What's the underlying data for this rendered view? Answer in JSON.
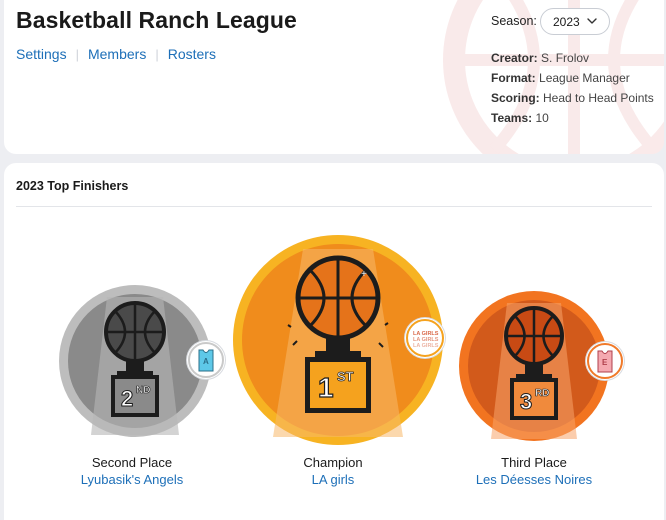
{
  "league": {
    "title": "Basketball Ranch League",
    "nav": [
      {
        "label": "Settings"
      },
      {
        "label": "Members"
      },
      {
        "label": "Rosters"
      }
    ]
  },
  "season": {
    "label": "Season:",
    "selected": "2023"
  },
  "details": [
    {
      "key": "Creator:",
      "value": "S. Frolov"
    },
    {
      "key": "Format:",
      "value": "League Manager"
    },
    {
      "key": "Scoring:",
      "value": "Head to Head Points"
    },
    {
      "key": "Teams:",
      "value": "10"
    }
  ],
  "finishers": {
    "title": "2023 Top Finishers",
    "items": [
      {
        "place": "Second Place",
        "team": "Lyubasik's Angels",
        "rank_num": "2",
        "rank_suffix": "ND",
        "icon": "trophy-icon"
      },
      {
        "place": "Champion",
        "team": "LA girls",
        "rank_num": "1",
        "rank_suffix": "ST",
        "icon": "trophy-icon"
      },
      {
        "place": "Third Place",
        "team": "Les Déesses Noires",
        "rank_num": "3",
        "rank_suffix": "RD",
        "icon": "trophy-icon"
      }
    ],
    "logo_text": "LA GIRLS"
  },
  "colors": {
    "link": "#1d6fb8",
    "silver": "#c8c8c8",
    "gold": "#f4a61d",
    "bronze": "#f07a2a"
  }
}
